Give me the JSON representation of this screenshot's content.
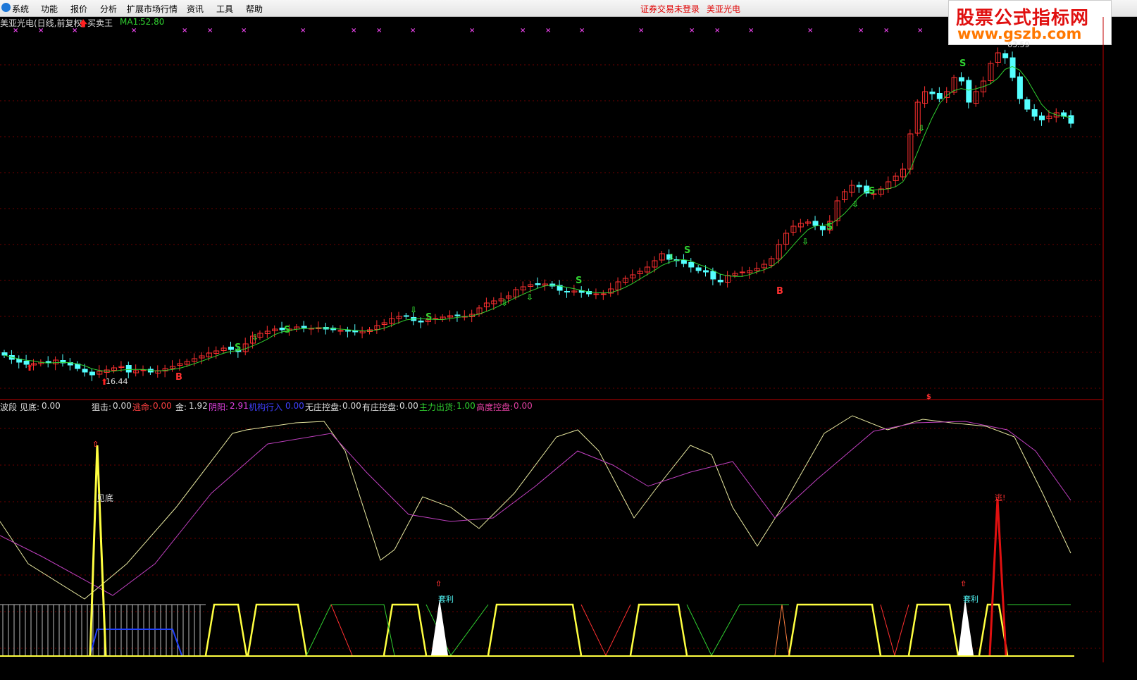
{
  "menu": {
    "items": [
      "系统",
      "功能",
      "报价",
      "分析",
      "扩展市场行情",
      "资讯",
      "工具",
      "帮助"
    ],
    "login_status": "证券交易未登录",
    "stock_name": "美亚光电"
  },
  "watermark": {
    "line1": "股票公式指标网",
    "line2": "www.gszb.com"
  },
  "header": {
    "title": "美亚光电(日线,前复权)",
    "indicator_name": "买卖王",
    "ma_label": "MA1:",
    "ma_value": "52.80"
  },
  "price_labels": {
    "high": "63.59",
    "low": "16.44"
  },
  "indicator_bar": {
    "name": "波段",
    "items": [
      {
        "label": "见底:",
        "value": "0.00",
        "color": "#dddddd"
      },
      {
        "label": "狙击:",
        "value": "0.00",
        "color": "#dddddd"
      },
      {
        "label": "逃命:",
        "value": "0.00",
        "color": "#ff4040"
      },
      {
        "label": "金:",
        "value": "1.92",
        "color": "#dddddd"
      },
      {
        "label": "阴阳:",
        "value": "2.91",
        "color": "#e040e0"
      },
      {
        "label": "机构行入",
        "value": "0.00",
        "color": "#4040ff"
      },
      {
        "label": "无庄控盘:",
        "value": "0.00",
        "color": "#dddddd"
      },
      {
        "label": "有庄控盘:",
        "value": "0.00",
        "color": "#dddddd"
      },
      {
        "label": "主力出货:",
        "value": "1.00",
        "color": "#30d030"
      },
      {
        "label": "高度控盘:",
        "value": "0.00",
        "color": "#e040a0"
      }
    ]
  },
  "signal_text": {
    "buy": "B",
    "sell": "S",
    "bottom": "见底",
    "arbitrage": "套利",
    "escape": "逃!"
  },
  "colors": {
    "background": "#000000",
    "up_candle": "#ff3030",
    "down_candle": "#54ffff",
    "ma_line": "#30d030",
    "kline": "#e8e8a0",
    "dline": "#c040c0",
    "gridline": "#6e0000",
    "separator": "#c00000"
  },
  "chart_data": {
    "type": "candlestick",
    "ylabel": "",
    "ma": {
      "name": "MA1",
      "value": 52.8
    },
    "high": 63.59,
    "low": 16.44,
    "closes": [
      19.6,
      19.0,
      18.6,
      18.3,
      18.4,
      18.6,
      18.5,
      18.9,
      18.5,
      18.2,
      17.7,
      17.2,
      16.8,
      17.3,
      17.5,
      17.8,
      18.0,
      17.2,
      17.4,
      17.5,
      17.2,
      17.4,
      17.7,
      18.0,
      18.4,
      18.7,
      19.1,
      19.5,
      19.9,
      20.2,
      20.6,
      20.4,
      20.1,
      21.2,
      22.3,
      22.7,
      23.0,
      23.3,
      23.2,
      23.3,
      23.6,
      23.5,
      23.4,
      23.5,
      23.3,
      23.2,
      23.1,
      23.0,
      22.9,
      23.0,
      23.2,
      23.8,
      24.2,
      24.8,
      25.1,
      25.1,
      24.5,
      24.3,
      24.6,
      24.8,
      25.0,
      25.2,
      25.2,
      25.1,
      25.4,
      26.3,
      27.0,
      27.3,
      27.6,
      28.0,
      28.9,
      29.3,
      29.6,
      29.6,
      29.7,
      29.4,
      28.8,
      28.6,
      28.7,
      28.5,
      28.3,
      28.3,
      28.3,
      29.0,
      30.0,
      30.5,
      31.0,
      31.5,
      32.1,
      33.0,
      34.0,
      33.2,
      33.0,
      32.6,
      32.1,
      31.6,
      31.4,
      30.4,
      30.0,
      30.9,
      31.2,
      31.4,
      31.6,
      31.9,
      32.5,
      33.3,
      35.3,
      36.9,
      37.9,
      38.3,
      38.5,
      38.0,
      37.4,
      38.6,
      41.5,
      42.8,
      43.7,
      43.5,
      42.6,
      42.5,
      43.2,
      44.2,
      45.0,
      46.0,
      51.0,
      55.5,
      57.0,
      56.7,
      56.0,
      57.0,
      59.0,
      58.5,
      55.5,
      57.0,
      58.5,
      61.0,
      62.5,
      61.8,
      59.0,
      56.0,
      54.5,
      53.5,
      53.0,
      53.5,
      54.0,
      53.5,
      52.5
    ]
  }
}
